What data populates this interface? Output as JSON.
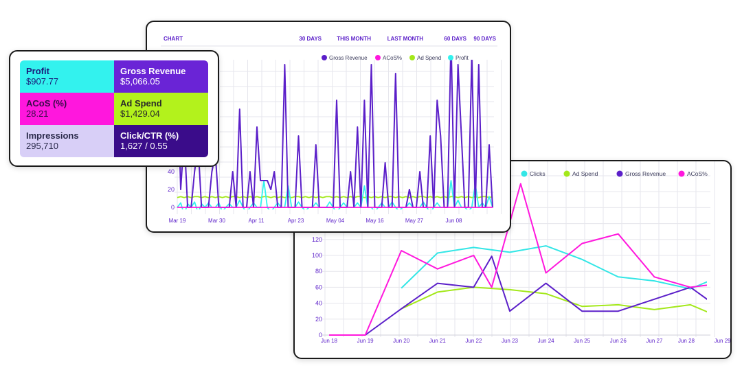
{
  "kpis": [
    {
      "label": "Profit",
      "value": "$907.77",
      "bg": "#33f2ee",
      "fg": "#1a1a7a"
    },
    {
      "label": "Gross Revenue",
      "value": "$5,066.05",
      "bg": "#6a24d6",
      "fg": "#ffffff"
    },
    {
      "label": "ACoS (%)",
      "value": "28.21",
      "bg": "#ff17dd",
      "fg": "#3a0a4a"
    },
    {
      "label": "Ad Spend",
      "value": "$1,429.04",
      "bg": "#b3f21c",
      "fg": "#2a2a2a"
    },
    {
      "label": "Impressions",
      "value": "295,710",
      "bg": "#d8cff7",
      "fg": "#2a2a4a"
    },
    {
      "label": "Click/CTR (%)",
      "value": "1,627 / 0.55",
      "bg": "#3a0c8a",
      "fg": "#ffffff"
    }
  ],
  "chart1": {
    "title": "CHART",
    "ranges": [
      "30 DAYS",
      "THIS MONTH",
      "LAST MONTH",
      "60 DAYS",
      "90 DAYS"
    ]
  },
  "chart_data": [
    {
      "type": "line",
      "x_ticks": [
        "Mar 19",
        "Mar 30",
        "Apr 11",
        "Apr 23",
        "May 04",
        "May 16",
        "May 27",
        "Jun 08"
      ],
      "y_ticks": [
        "0",
        "20",
        "40"
      ],
      "legend_position": "top-right",
      "grid": true,
      "series": [
        {
          "name": "Gross Revenue",
          "color": "#5b1fc9",
          "values": [
            160,
            20,
            80,
            0,
            0,
            40,
            70,
            0,
            0,
            0,
            40,
            60,
            0,
            0,
            0,
            0,
            40,
            0,
            110,
            0,
            0,
            40,
            0,
            90,
            30,
            30,
            30,
            20,
            40,
            0,
            0,
            160,
            0,
            0,
            0,
            80,
            0,
            0,
            0,
            0,
            70,
            0,
            0,
            0,
            0,
            0,
            120,
            0,
            0,
            0,
            40,
            0,
            90,
            0,
            120,
            0,
            160,
            0,
            0,
            0,
            50,
            0,
            0,
            150,
            0,
            0,
            0,
            20,
            0,
            0,
            40,
            0,
            0,
            80,
            0,
            120,
            80,
            0,
            0,
            190,
            0,
            160,
            80,
            0,
            0,
            170,
            0,
            160,
            0,
            0,
            70,
            0
          ]
        },
        {
          "name": "ACoS%",
          "color": "#ff17dd",
          "values": [
            0,
            0,
            0,
            0,
            0,
            0,
            0,
            0,
            0,
            0,
            0,
            0,
            0,
            0,
            0,
            0,
            0,
            0,
            0,
            0,
            0,
            0,
            0,
            0,
            0,
            0,
            0,
            0,
            0,
            0,
            0,
            0,
            0,
            0,
            0,
            0,
            0,
            0,
            0,
            0,
            0,
            0,
            0,
            0,
            0,
            0,
            0,
            0,
            0,
            0,
            0,
            0,
            0,
            0,
            0,
            0,
            0,
            0,
            0,
            0,
            0,
            0,
            0,
            0,
            0,
            0,
            0,
            0,
            0,
            0,
            0,
            0,
            0,
            0,
            0,
            0,
            0,
            0,
            0,
            0,
            0,
            0,
            0,
            0,
            0,
            0,
            0,
            0,
            0,
            0,
            0,
            0
          ]
        },
        {
          "name": "Ad Spend",
          "color": "#a3e81a",
          "values": [
            11,
            12,
            11,
            12,
            11,
            12,
            12,
            11,
            12,
            11,
            12,
            11,
            12,
            11,
            12,
            11,
            12,
            12,
            11,
            12,
            11,
            12,
            11,
            12,
            11,
            12,
            12,
            11,
            12,
            11,
            12,
            11,
            12,
            11,
            12,
            12,
            11,
            12,
            11,
            12,
            11,
            12,
            11,
            12,
            12,
            11,
            12,
            11,
            12,
            11,
            12,
            11,
            12,
            12,
            11,
            12,
            11,
            12,
            11,
            12,
            11,
            12,
            12,
            11,
            12,
            11,
            12,
            11,
            12,
            11,
            12,
            12,
            11,
            12,
            11,
            12,
            11,
            12,
            11,
            12,
            12,
            11,
            12,
            11,
            12,
            11,
            12,
            11,
            12,
            12,
            11,
            12
          ]
        },
        {
          "name": "Profit",
          "color": "#33f2ee",
          "values": [
            0,
            5,
            -8,
            4,
            0,
            6,
            -6,
            4,
            0,
            5,
            0,
            0,
            5,
            -5,
            0,
            4,
            0,
            0,
            8,
            0,
            -6,
            0,
            5,
            0,
            0,
            30,
            0,
            -5,
            0,
            5,
            0,
            0,
            24,
            0,
            0,
            6,
            0,
            -4,
            0,
            0,
            5,
            0,
            0,
            0,
            6,
            0,
            -6,
            0,
            5,
            0,
            0,
            0,
            5,
            0,
            24,
            0,
            0,
            -5,
            0,
            5,
            0,
            0,
            6,
            0,
            -4,
            0,
            0,
            5,
            0,
            0,
            0,
            6,
            0,
            -6,
            0,
            5,
            0,
            0,
            0,
            30,
            0,
            8,
            0,
            0,
            -4,
            0,
            26,
            0,
            5,
            0,
            12,
            0
          ]
        }
      ]
    },
    {
      "type": "line",
      "categories": [
        "Jun 18",
        "Jun 19",
        "Jun 20",
        "Jun 21",
        "Jun 22",
        "Jun 23",
        "Jun 24",
        "Jun 25",
        "Jun 26",
        "Jun 27",
        "Jun 28",
        "Jun 29"
      ],
      "y_ticks": [
        "0",
        "20",
        "40",
        "60",
        "80",
        "100",
        "120"
      ],
      "legend_position": "top-right",
      "grid": true,
      "series": [
        {
          "name": "Clicks",
          "color": "#33e6e6",
          "x": [
            20,
            21,
            22,
            23,
            24,
            25,
            26,
            27,
            28,
            29
          ],
          "values": [
            59,
            103,
            110,
            104,
            112,
            95,
            73,
            68,
            58,
            75
          ]
        },
        {
          "name": "Ad Spend",
          "color": "#a3e81a",
          "x": [
            20,
            21,
            22,
            23,
            24,
            25,
            26,
            27,
            28,
            29
          ],
          "values": [
            33,
            54,
            60,
            57,
            52,
            36,
            38,
            32,
            38,
            21
          ]
        },
        {
          "name": "Gross Revenue",
          "color": "#5b1fc9",
          "x": [
            19,
            20,
            21,
            22,
            22.5,
            23,
            24,
            25,
            26,
            27,
            28,
            29
          ],
          "values": [
            0,
            33,
            65,
            60,
            99,
            30,
            65,
            30,
            30,
            45,
            60,
            31
          ]
        },
        {
          "name": "ACoS%",
          "color": "#ff17dd",
          "x": [
            18,
            19,
            20,
            21,
            22,
            22.5,
            23.3,
            24,
            25,
            26,
            27,
            28,
            29
          ],
          "values": [
            0,
            0,
            106,
            83,
            100,
            60,
            190,
            78,
            115,
            127,
            73,
            60,
            65
          ]
        }
      ]
    }
  ]
}
